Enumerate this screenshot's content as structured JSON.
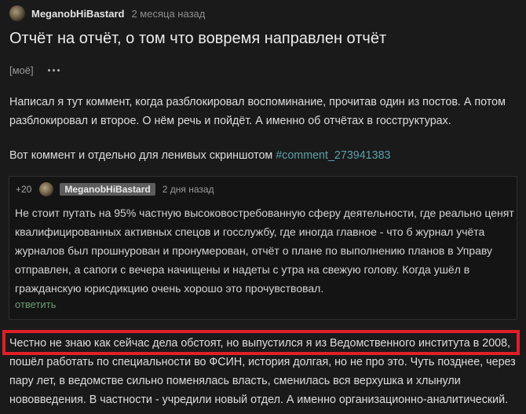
{
  "post": {
    "author": "MeganobHiBastard",
    "time": "2 месяца назад",
    "title": "Отчёт на отчёт, о том что вовремя направлен отчёт",
    "tag": "[моё]",
    "paragraph1": [
      "Написал я тут коммент, когда разблокировал воспоминание, прочитав один из постов. А потом",
      "разблокировал и второе. О нём речь и пойдёт. А именно об отчётах в госструктурах."
    ],
    "paragraph2_text": "Вот коммент и отдельно для ленивых скриншотом ",
    "paragraph2_link": "#comment_273941383",
    "paragraph3": [
      "Честно не знаю как сейчас дела обстоят, но выпустился я из Ведомственного института в 2008,",
      "пошёл работать по специальности во ФСИН, история долгая, но не про это. Чуть позднее, через",
      "пару лет, в ведомстве сильно поменялась власть, сменилась вся верхушка и хлынули",
      "нововведения. В частности - учредили новый отдел. А именно организационно-аналитический."
    ]
  },
  "comment": {
    "rating": "+20",
    "author": "MeganobHiBastard",
    "time": "2 дня назад",
    "lines": [
      "Не стоит путать на 95% частную высоковостребованную сферу деятельности, где реально ценят",
      "квалифицированных активных спецов и госслужбу, где иногда главное - что б журнал учёта",
      "журналов был прошнурован и пронумерован, отчёт о плане по выполнению планов в Управу",
      "отправлен, а сапоги с вечера начищены и надеты с утра на свежую голову. Когда ушёл в",
      "гражданскую юрисдикцию очень хорошо это прочувствовал."
    ],
    "reply_label": "ответить"
  },
  "colors": {
    "background": "#1a1a1b",
    "link": "#5aa0a9",
    "reply": "#6a9a72",
    "highlight_border": "#e01f27"
  }
}
